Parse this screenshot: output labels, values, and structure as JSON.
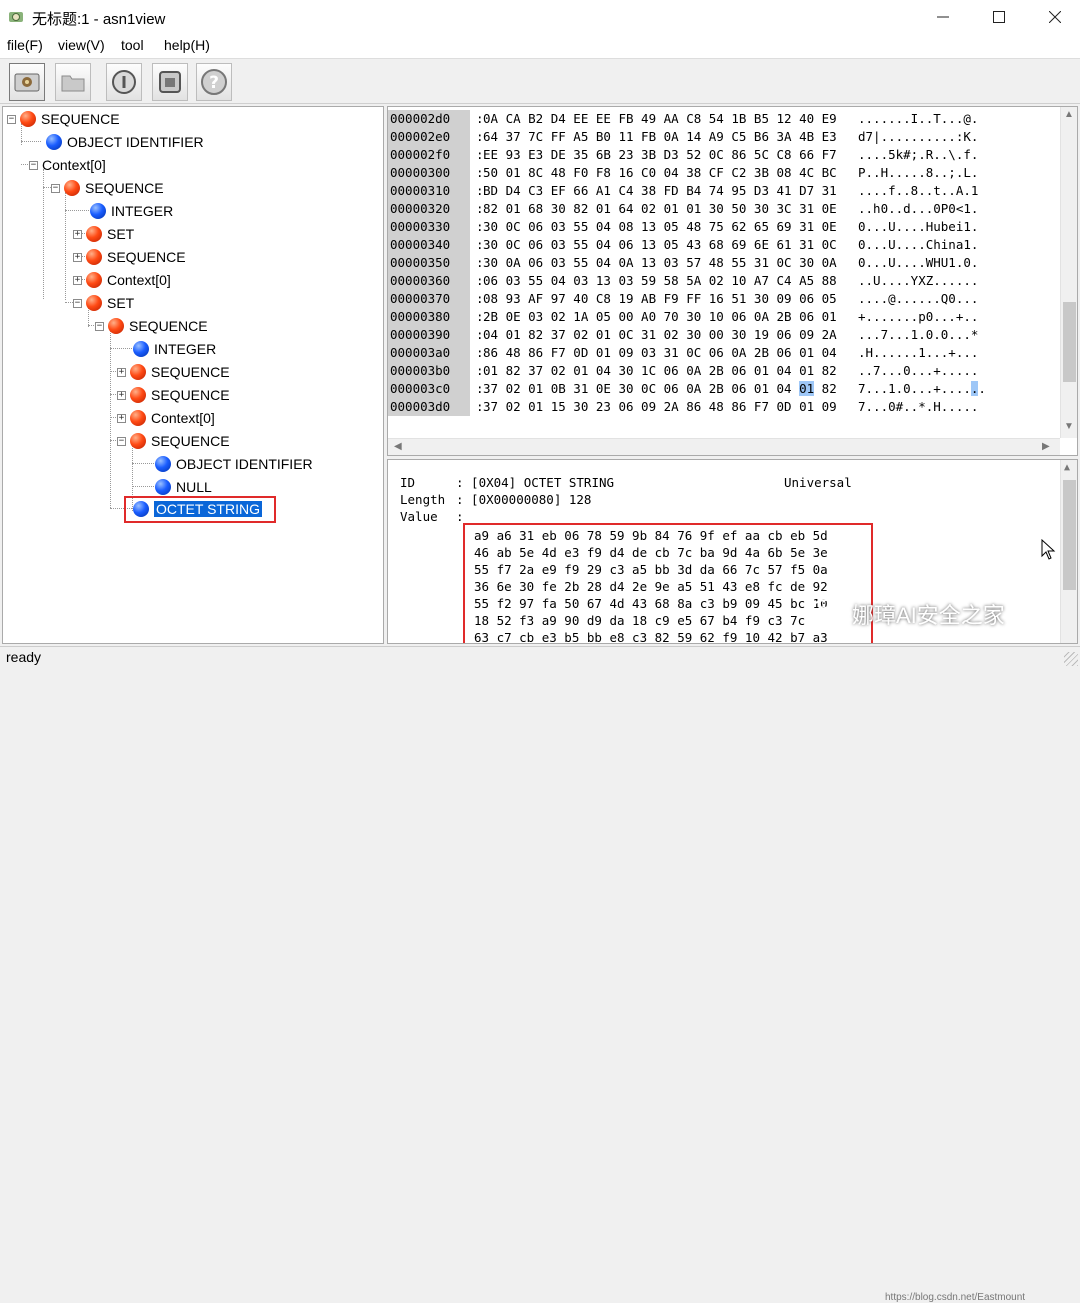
{
  "window": {
    "title": "无标题:1 - asn1view",
    "icon": "app-icon",
    "controls": [
      "minimize-icon",
      "maximize-icon",
      "close-icon"
    ]
  },
  "menu": [
    "file(F)",
    "view(V)",
    "tool",
    "help(H)"
  ],
  "toolbar": [
    "open-record-icon",
    "folder-icon",
    "info-icon",
    "save-icon",
    "help-icon"
  ],
  "tree": [
    {
      "label": "SEQUENCE",
      "color": "red",
      "exp": "-"
    },
    {
      "label": "OBJECT IDENTIFIER",
      "color": "blue",
      "exp": ""
    },
    {
      "label": "Context[0]",
      "color": "",
      "exp": "-"
    },
    {
      "label": "SEQUENCE",
      "color": "red",
      "exp": "-"
    },
    {
      "label": "INTEGER",
      "color": "blue",
      "exp": ""
    },
    {
      "label": "SET",
      "color": "red",
      "exp": "+"
    },
    {
      "label": "SEQUENCE",
      "color": "red",
      "exp": "+"
    },
    {
      "label": "Context[0]",
      "color": "red",
      "exp": "+"
    },
    {
      "label": "SET",
      "color": "red",
      "exp": "-"
    },
    {
      "label": "SEQUENCE",
      "color": "red",
      "exp": "-"
    },
    {
      "label": "INTEGER",
      "color": "blue",
      "exp": ""
    },
    {
      "label": "SEQUENCE",
      "color": "red",
      "exp": "+"
    },
    {
      "label": "SEQUENCE",
      "color": "red",
      "exp": "+"
    },
    {
      "label": "Context[0]",
      "color": "red",
      "exp": "+"
    },
    {
      "label": "SEQUENCE",
      "color": "red",
      "exp": "-"
    },
    {
      "label": "OBJECT IDENTIFIER",
      "color": "blue",
      "exp": ""
    },
    {
      "label": "NULL",
      "color": "blue",
      "exp": ""
    },
    {
      "label": "OCTET STRING",
      "color": "blue",
      "exp": "",
      "selected": true
    }
  ],
  "hex": [
    {
      "addr": "000002d0",
      "bytes": "0A CA B2 D4 EE EE FB 49 AA C8 54 1B B5 12 40 E9",
      "ascii": ".......I..T...@."
    },
    {
      "addr": "000002e0",
      "bytes": "64 37 7C FF A5 B0 11 FB 0A 14 A9 C5 B6 3A 4B E3",
      "ascii": "d7|..........:K."
    },
    {
      "addr": "000002f0",
      "bytes": "EE 93 E3 DE 35 6B 23 3B D3 52 0C 86 5C C8 66 F7",
      "ascii": "....5k#;.R..\\.f."
    },
    {
      "addr": "00000300",
      "bytes": "50 01 8C 48 F0 F8 16 C0 04 38 CF C2 3B 08 4C BC",
      "ascii": "P..H.....8..;.L."
    },
    {
      "addr": "00000310",
      "bytes": "BD D4 C3 EF 66 A1 C4 38 FD B4 74 95 D3 41 D7 31",
      "ascii": "....f..8..t..A.1"
    },
    {
      "addr": "00000320",
      "bytes": "82 01 68 30 82 01 64 02 01 01 30 50 30 3C 31 0E",
      "ascii": "..h0..d...0P0<1."
    },
    {
      "addr": "00000330",
      "bytes": "30 0C 06 03 55 04 08 13 05 48 75 62 65 69 31 0E",
      "ascii": "0...U....Hubei1."
    },
    {
      "addr": "00000340",
      "bytes": "30 0C 06 03 55 04 06 13 05 43 68 69 6E 61 31 0C",
      "ascii": "0...U....China1."
    },
    {
      "addr": "00000350",
      "bytes": "30 0A 06 03 55 04 0A 13 03 57 48 55 31 0C 30 0A",
      "ascii": "0...U....WHU1.0."
    },
    {
      "addr": "00000360",
      "bytes": "06 03 55 04 03 13 03 59 58 5A 02 10 A7 C4 A5 88",
      "ascii": "..U....YXZ......"
    },
    {
      "addr": "00000370",
      "bytes": "08 93 AF 97 40 C8 19 AB F9 FF 16 51 30 09 06 05",
      "ascii": "....@......Q0..."
    },
    {
      "addr": "00000380",
      "bytes": "2B 0E 03 02 1A 05 00 A0 70 30 10 06 0A 2B 06 01",
      "ascii": "+.......p0...+.."
    },
    {
      "addr": "00000390",
      "bytes": "04 01 82 37 02 01 0C 31 02 30 00 30 19 06 09 2A",
      "ascii": "...7...1.0.0...*"
    },
    {
      "addr": "000003a0",
      "bytes": "86 48 86 F7 0D 01 09 03 31 0C 06 0A 2B 06 01 04",
      "ascii": ".H......1...+..."
    },
    {
      "addr": "000003b0",
      "bytes": "01 82 37 02 01 04 30 1C 06 0A 2B 06 01 04 01 82",
      "ascii": "..7...0...+....."
    },
    {
      "addr": "000003c0",
      "bytes_pre": "37 02 01 0B 31 0E 30 0C 06 0A 2B 06 01 04 ",
      "bytes_sel": "01",
      "bytes_post": " 82",
      "ascii_pre": "7...1.0...+....",
      "ascii_sel": ".",
      "ascii_post": "."
    },
    {
      "addr": "000003d0",
      "bytes": "37 02 01 15 30 23 06 09 2A 86 48 86 F7 0D 01 09",
      "ascii": "7...0#..*.H....."
    }
  ],
  "info": {
    "id_label": "ID",
    "id_value": ": [0X04] OCTET STRING",
    "class": "Universal",
    "length_label": "Length",
    "length_value": ": [0X00000080] 128",
    "value_label": "Value",
    "value_colon": ":",
    "value_rows": [
      "a9 a6 31 eb 06 78 59 9b 84 76 9f ef aa cb eb 5d",
      "46 ab 5e 4d e3 f9 d4 de cb 7c ba 9d 4a 6b 5e 3e",
      "55 f7 2a e9 f9 29 c3 a5 bb 3d da 66 7c 57 f5 0a",
      "36 6e 30 fe 2b 28 d4 2e 9e a5 51 43 e8 fc de 92",
      "55 f2 97 fa 50 67 4d 43 68 8a c3 b9 09 45 bc 10",
      "18 52 f3 a9 90 d9 da 18 c9 e5 67 b4 f9 c3 7c",
      "63 c7 cb e3 b5 bb e8 c3 82 59 62 f9 10 42 b7 a3"
    ]
  },
  "status": "ready",
  "watermark": {
    "text": "娜璋AI安全之家",
    "url": "https://blog.csdn.net/Eastmount"
  }
}
